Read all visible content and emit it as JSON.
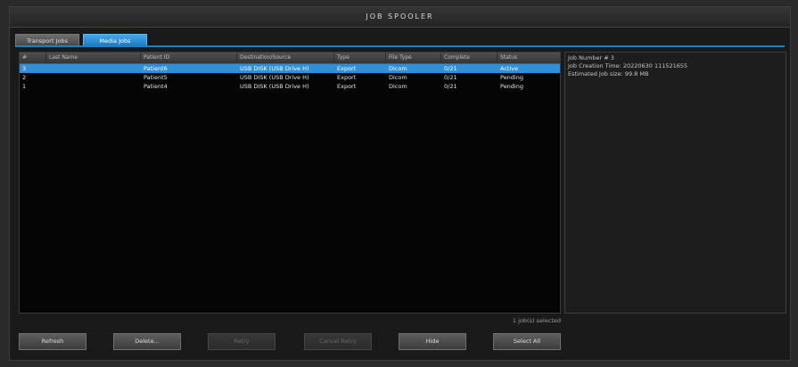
{
  "window": {
    "title": "JOB SPOOLER"
  },
  "tabs": [
    {
      "label": "Transport Jobs",
      "active": false
    },
    {
      "label": "Media Jobs",
      "active": true
    }
  ],
  "table": {
    "headers": [
      "#",
      "Last Name",
      "Patient ID",
      "Destination/Source",
      "Type",
      "File Type",
      "Complete",
      "Status"
    ],
    "rows": [
      {
        "num": "3",
        "last_name": "",
        "patient_id": "Patient6",
        "destination": "USB DISK (USB Drive H)",
        "type": "Export",
        "file_type": "Dicom",
        "complete": "0/21",
        "status": "Active",
        "selected": true
      },
      {
        "num": "2",
        "last_name": "",
        "patient_id": "Patient5",
        "destination": "USB DISK (USB Drive H)",
        "type": "Export",
        "file_type": "Dicom",
        "complete": "0/21",
        "status": "Pending",
        "selected": false
      },
      {
        "num": "1",
        "last_name": "",
        "patient_id": "Patient4",
        "destination": "USB DISK (USB Drive H)",
        "type": "Export",
        "file_type": "Dicom",
        "complete": "0/21",
        "status": "Pending",
        "selected": false
      }
    ]
  },
  "info": {
    "job_number": "Job Number # 3",
    "job_creation_time": "Job Creation Time: 20220630 111521655",
    "estimated_size": "Estimated Job size: 99.8 MB"
  },
  "selection": {
    "count_label": "1 job(s) selected"
  },
  "buttons": {
    "refresh": "Refresh",
    "delete": "Delete...",
    "retry": "Retry",
    "cancel_retry": "Cancel Retry",
    "hide": "Hide",
    "select_all": "Select All"
  },
  "colors": {
    "selection": "#2f8fd8",
    "active_tab": "#1f7dc4"
  }
}
